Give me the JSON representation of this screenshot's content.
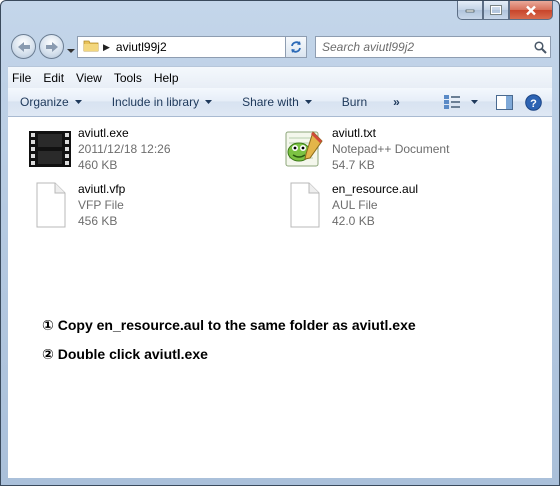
{
  "address": {
    "path": "aviutl99j2"
  },
  "search": {
    "placeholder": "Search aviutl99j2"
  },
  "menu": [
    "File",
    "Edit",
    "View",
    "Tools",
    "Help"
  ],
  "commands": {
    "organize": "Organize",
    "include": "Include in library",
    "share": "Share with",
    "burn": "Burn",
    "more": "»"
  },
  "files": [
    {
      "name": "aviutl.exe",
      "line2": "2011/12/18 12:26",
      "line3": "460 KB",
      "icon": "film-strip-icon"
    },
    {
      "name": "aviutl.txt",
      "line2": "Notepad++ Document",
      "line3": "54.7 KB",
      "icon": "notepadpp-icon"
    },
    {
      "name": "aviutl.vfp",
      "line2": "VFP File",
      "line3": "456 KB",
      "icon": "blank-file-icon"
    },
    {
      "name": "en_resource.aul",
      "line2": "AUL File",
      "line3": "42.0 KB",
      "icon": "blank-file-icon"
    }
  ],
  "instructions": [
    "① Copy en_resource.aul to the same folder as aviutl.exe",
    "② Double click aviutl.exe"
  ]
}
